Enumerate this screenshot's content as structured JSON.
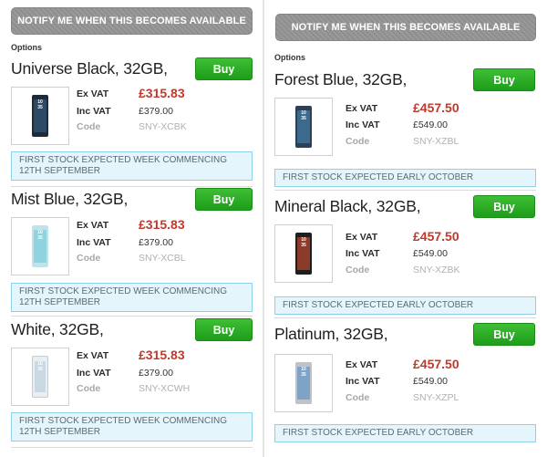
{
  "notify_label": "NOTIFY ME WHEN THIS BECOMES AVAILABLE",
  "options_label": "Options",
  "buy_label": "Buy",
  "ex_vat_label": "Ex VAT",
  "inc_vat_label": "Inc VAT",
  "code_label": "Code",
  "colors": {
    "price": "#c0392b",
    "buy": "#28a824",
    "stock_bg": "#e4f6fc",
    "stock_border": "#8fd0ea"
  },
  "left": {
    "products": [
      {
        "title": "Universe Black, 32GB,",
        "ex_vat": "£315.83",
        "inc_vat": "£379.00",
        "code": "SNY-XCBK",
        "stock": "FIRST STOCK EXPECTED WEEK COMMENCING 12TH SEPTEMBER",
        "phone_color": "#1d2a38",
        "screen_color": "#2c4a66",
        "clock_top": "10",
        "clock_bottom": "35"
      },
      {
        "title": "Mist Blue, 32GB,",
        "ex_vat": "£315.83",
        "inc_vat": "£379.00",
        "code": "SNY-XCBL",
        "stock": "FIRST STOCK EXPECTED WEEK COMMENCING 12TH SEPTEMBER",
        "phone_color": "#bfe3ea",
        "screen_color": "#8fd3df",
        "clock_top": "10",
        "clock_bottom": "35"
      },
      {
        "title": "White, 32GB,",
        "ex_vat": "£315.83",
        "inc_vat": "£379.00",
        "code": "SNY-XCWH",
        "stock": "FIRST STOCK EXPECTED WEEK COMMENCING 12TH SEPTEMBER",
        "phone_color": "#e9eef2",
        "screen_color": "#c9d9e3",
        "clock_top": "10",
        "clock_bottom": "35"
      }
    ]
  },
  "right": {
    "products": [
      {
        "title": "Forest Blue, 32GB,",
        "ex_vat": "£457.50",
        "inc_vat": "£549.00",
        "code": "SNY-XZBL",
        "stock": "FIRST STOCK EXPECTED EARLY OCTOBER",
        "phone_color": "#2d3f55",
        "screen_color": "#3b6a8c",
        "clock_top": "10",
        "clock_bottom": "35"
      },
      {
        "title": "Mineral Black, 32GB,",
        "ex_vat": "£457.50",
        "inc_vat": "£549.00",
        "code": "SNY-XZBK",
        "stock": "FIRST STOCK EXPECTED EARLY OCTOBER",
        "phone_color": "#1e1e1e",
        "screen_color": "#8a3b2a",
        "clock_top": "10",
        "clock_bottom": "35"
      },
      {
        "title": "Platinum, 32GB,",
        "ex_vat": "£457.50",
        "inc_vat": "£549.00",
        "code": "SNY-XZPL",
        "stock": "FIRST STOCK EXPECTED EARLY OCTOBER",
        "phone_color": "#bfc3c7",
        "screen_color": "#7fa3c7",
        "clock_top": "10",
        "clock_bottom": "35"
      }
    ]
  }
}
